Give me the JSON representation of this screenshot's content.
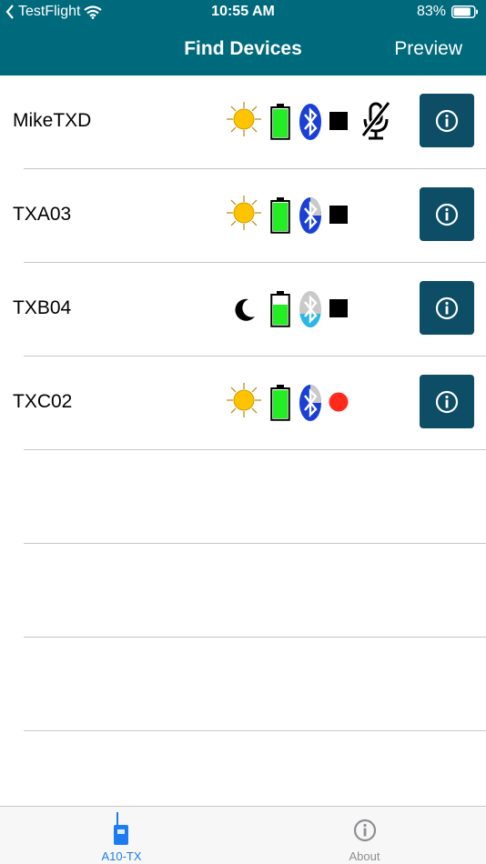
{
  "status_bar": {
    "carrier": "TestFlight",
    "time": "10:55 AM",
    "battery": "83%",
    "battery_level": 0.83
  },
  "nav": {
    "title": "Find Devices",
    "right_button": "Preview"
  },
  "devices": [
    {
      "name": "MikeTXD",
      "mode_icon": "sun-icon",
      "battery_level": 1.0,
      "bluetooth": "connected",
      "state_icon": "stop-square-icon",
      "mic_muted": true
    },
    {
      "name": "TXA03",
      "mode_icon": "sun-icon",
      "battery_level": 1.0,
      "bluetooth": "connected",
      "state_icon": "stop-square-icon",
      "mic_muted": false
    },
    {
      "name": "TXB04",
      "mode_icon": "moon-icon",
      "battery_level": 0.7,
      "bluetooth": "low",
      "state_icon": "stop-square-icon",
      "mic_muted": false
    },
    {
      "name": "TXC02",
      "mode_icon": "sun-icon",
      "battery_level": 1.0,
      "bluetooth": "connected",
      "state_icon": "record-dot-icon",
      "mic_muted": false
    }
  ],
  "tabs": [
    {
      "label": "A10-TX",
      "icon": "radio-transmitter-icon",
      "active": true
    },
    {
      "label": "About",
      "icon": "info-icon",
      "active": false
    }
  ],
  "colors": {
    "nav_bg": "#006a7d",
    "info_button": "#0d4d66",
    "battery_green": "#22ee22",
    "bluetooth_blue": "#1a3fd6",
    "record_red": "#ff2a1a",
    "sun_yellow": "#ffc400",
    "tab_active": "#1e7cf2",
    "tab_inactive": "#8e8e93"
  }
}
